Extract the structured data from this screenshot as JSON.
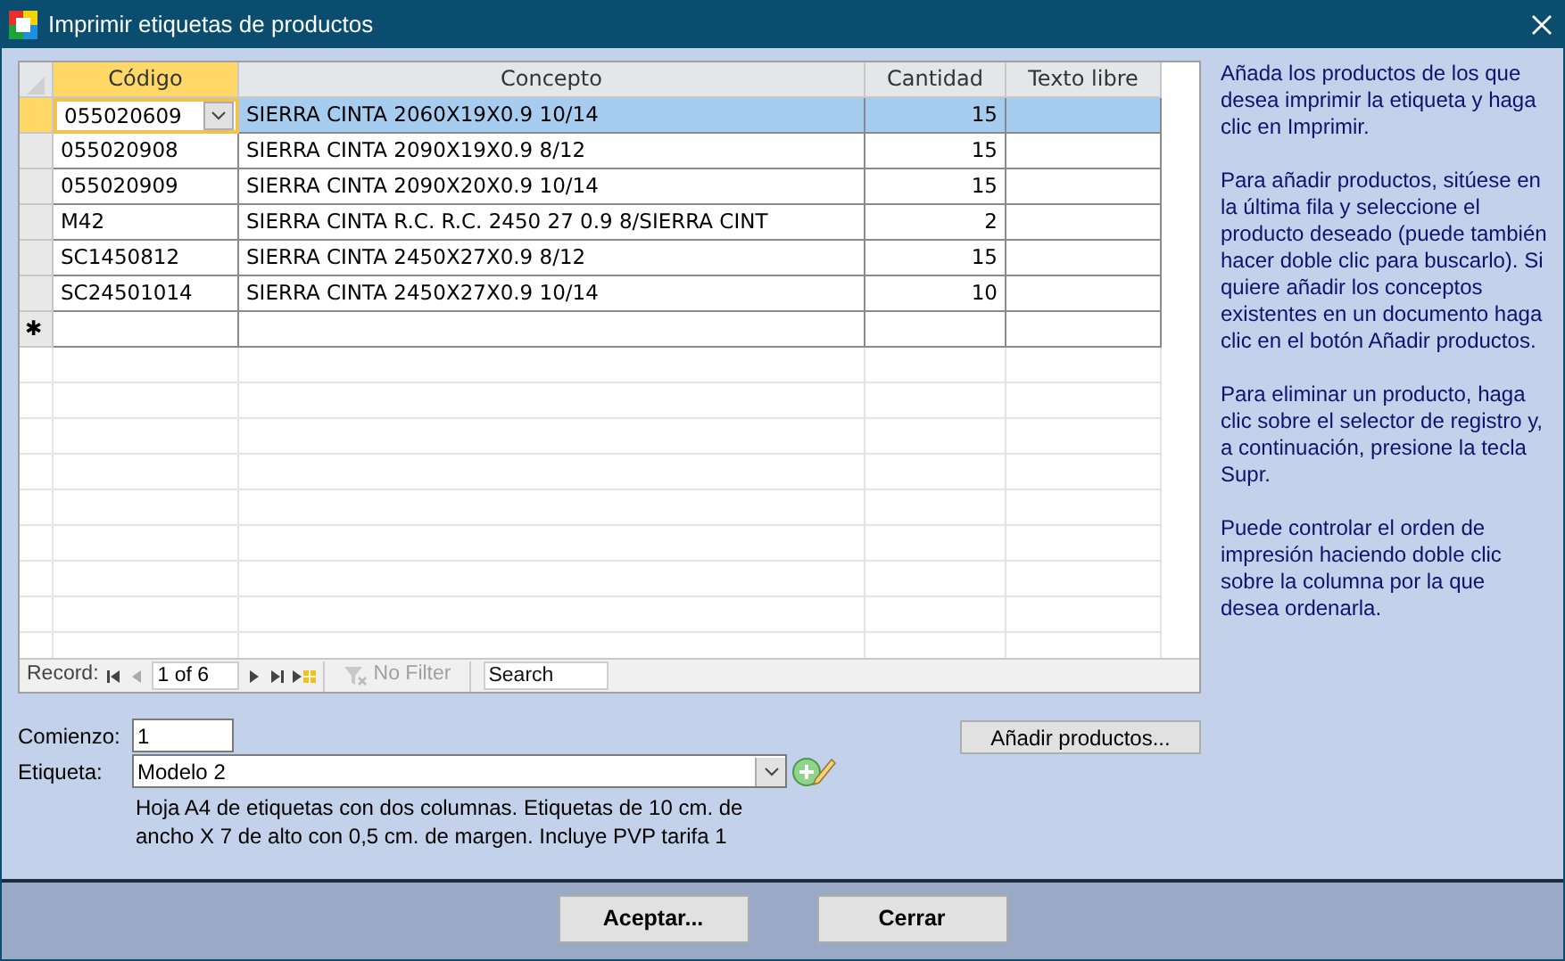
{
  "window": {
    "title": "Imprimir etiquetas de productos"
  },
  "table": {
    "columns": [
      {
        "label": "Código",
        "selected": true
      },
      {
        "label": "Concepto",
        "selected": false
      },
      {
        "label": "Cantidad",
        "selected": false
      },
      {
        "label": "Texto libre",
        "selected": false
      }
    ],
    "rows": [
      {
        "codigo": "055020609",
        "concepto": "SIERRA CINTA 2060X19X0.9 10/14",
        "cantidad": "15",
        "selected": true
      },
      {
        "codigo": "055020908",
        "concepto": "SIERRA CINTA 2090X19X0.9 8/12",
        "cantidad": "15",
        "selected": false
      },
      {
        "codigo": "055020909",
        "concepto": "SIERRA CINTA 2090X20X0.9 10/14",
        "cantidad": "15",
        "selected": false
      },
      {
        "codigo": "M42",
        "concepto": "SIERRA CINTA R.C. R.C. 2450 27 0.9 8/SIERRA CINT",
        "cantidad": "2",
        "selected": false
      },
      {
        "codigo": "SC1450812",
        "concepto": "SIERRA CINTA 2450X27X0.9 8/12",
        "cantidad": "15",
        "selected": false
      },
      {
        "codigo": "SC24501014",
        "concepto": "SIERRA CINTA 2450X27X0.9 10/14",
        "cantidad": "10",
        "selected": false
      }
    ],
    "new_row_marker": "✱"
  },
  "navigation": {
    "label": "Record:",
    "position": "1 of 6",
    "filter": "No Filter",
    "filter_disabled": true,
    "search_placeholder": "Search"
  },
  "help": [
    "Añada los productos de los que desea imprimir la etiqueta y haga clic en Imprimir.",
    "Para añadir productos, sitúese en la última fila y seleccione el producto deseado (puede también hacer doble clic para buscarlo). Si quiere añadir los conceptos existentes en un documento haga clic en el botón Añadir productos.",
    "Para eliminar un producto, haga clic sobre el selector de registro y, a continuación, presione la tecla Supr.",
    "Puede controlar el orden de impresión haciendo doble clic sobre la columna por la que desea ordenarla."
  ],
  "form": {
    "comienzo": {
      "label": "Comienzo:",
      "value": "1"
    },
    "etiqueta": {
      "label": "Etiqueta:",
      "value": "Modelo 2"
    },
    "description": "Hoja A4 de etiquetas con dos columnas. Etiquetas de 10 cm. de ancho X 7 de alto con 0,5 cm. de margen. Incluye PVP tarifa 1"
  },
  "add_button": "Añadir productos...",
  "buttons": [
    "Aceptar...",
    "Cerrar"
  ]
}
